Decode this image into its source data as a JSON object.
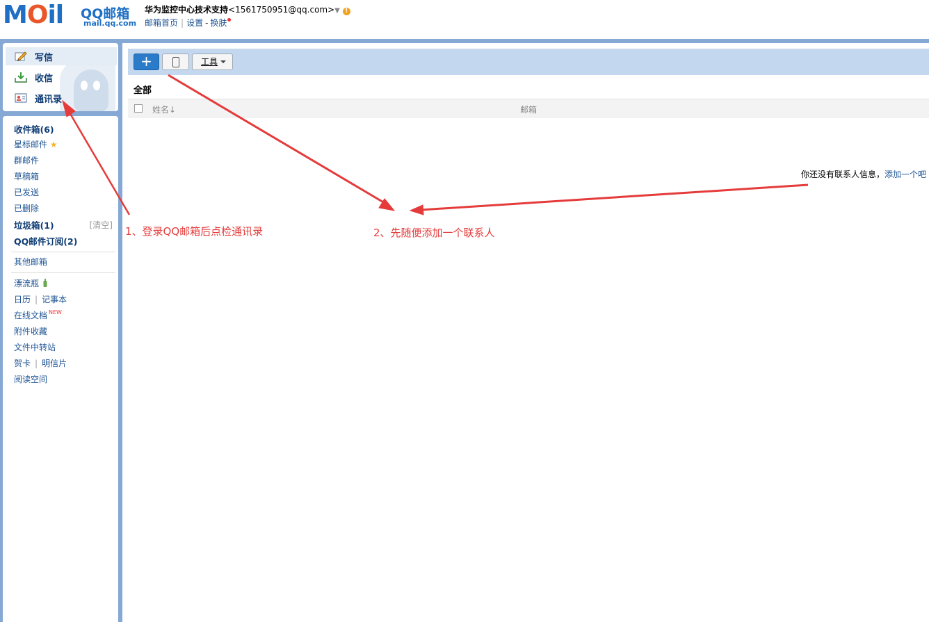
{
  "brand": {
    "logo_text": "MOil",
    "name": "QQ邮箱",
    "url": "mail.qq.com"
  },
  "account": {
    "name": "华为监控中心技术支持",
    "address": "<1561750951@qq.com>",
    "caret": "▼",
    "warn": "!"
  },
  "toplinks": {
    "home": "邮箱首页",
    "sep": "|",
    "settings": "设置",
    "dash": "-",
    "skin": "换肤"
  },
  "actions": {
    "compose": "写信",
    "receive": "收信",
    "contacts": "通讯录"
  },
  "folders": {
    "inbox": "收件箱(6)",
    "starred": "星标邮件",
    "group": "群邮件",
    "drafts": "草稿箱",
    "sent": "已发送",
    "deleted": "已删除",
    "spam": "垃圾箱(1)",
    "spam_clear": "[清空]",
    "subscriptions": "QQ邮件订阅(2)",
    "other_mailbox": "其他邮箱",
    "drift_bottle": "漂流瓶",
    "calendar": "日历",
    "sep": "|",
    "notebook": "记事本",
    "online_docs": "在线文档",
    "online_docs_badge": "NEW",
    "attachments": "附件收藏",
    "file_transfer": "文件中转站",
    "greeting_card": "贺卡",
    "postcard": "明信片",
    "reading_space": "阅读空间"
  },
  "toolbar": {
    "add_label": "+",
    "tools_label": "工具"
  },
  "contacts": {
    "group_title": "全部",
    "col_name": "姓名↓",
    "col_email": "邮箱",
    "empty_text": "你还没有联系人信息，",
    "empty_link": "添加一个吧"
  },
  "annotations": {
    "note1": "1、登录QQ邮箱后点检通讯录",
    "note2": "2、先随便添加一个联系人",
    "color": "#e53b3b"
  },
  "colors": {
    "frame": "#85a9d4",
    "toolbar": "#c3d8ef",
    "link": "#1e5494",
    "primary_button": "#2a7bc9"
  }
}
